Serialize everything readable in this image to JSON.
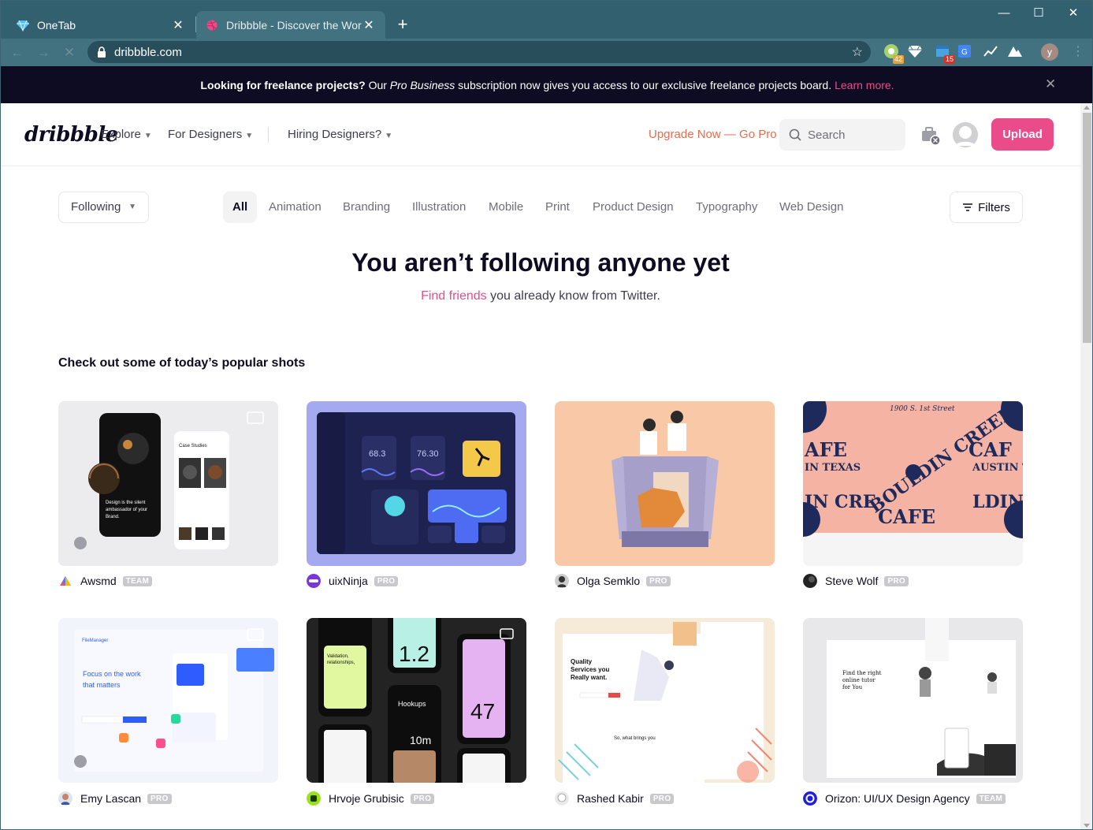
{
  "browser": {
    "tabs": [
      {
        "title": "OneTab",
        "active": false
      },
      {
        "title": "Dribbble - Discover the World",
        "active": true
      }
    ],
    "url": "dribbble.com",
    "extensions": [
      {
        "icon": "chrome-ext-icon",
        "badge": "42",
        "badge_color": "#e8a13a"
      },
      {
        "icon": "diamond-ext-icon",
        "badge": "",
        "badge_color": ""
      },
      {
        "icon": "calendar-ext-icon",
        "badge": "15",
        "badge_color": "#d93025"
      },
      {
        "icon": "translate-ext-icon",
        "badge": "",
        "badge_color": ""
      },
      {
        "icon": "chart-ext-icon",
        "badge": "",
        "badge_color": ""
      },
      {
        "icon": "mountain-ext-icon",
        "badge": "",
        "badge_color": ""
      }
    ],
    "profile_initial": "y"
  },
  "banner": {
    "lead": "Looking for freelance projects?",
    "mid1": "Our",
    "emph": "Pro Business",
    "rest": "subscription now gives you access to our exclusive freelance projects board.",
    "link": "Learn more."
  },
  "header": {
    "logo": "dribbble",
    "nav": [
      "Explore",
      "For Designers",
      "Hiring Designers?"
    ],
    "upgrade": "Upgrade Now — Go Pro",
    "search_placeholder": "Search",
    "upload": "Upload"
  },
  "filters": {
    "following": "Following",
    "categories": [
      "All",
      "Animation",
      "Branding",
      "Illustration",
      "Mobile",
      "Print",
      "Product Design",
      "Typography",
      "Web Design"
    ],
    "active_category": "All",
    "filters_label": "Filters"
  },
  "empty": {
    "title": "You aren’t following anyone yet",
    "link": "Find friends",
    "rest": "you already know from Twitter."
  },
  "popular_heading": "Check out some of today’s popular shots",
  "shots": [
    {
      "author": "Awsmd",
      "tag": "TEAM"
    },
    {
      "author": "uixNinja",
      "tag": "PRO"
    },
    {
      "author": "Olga Semklo",
      "tag": "PRO"
    },
    {
      "author": "Steve Wolf",
      "tag": "PRO"
    },
    {
      "author": "Emy Lascan",
      "tag": "PRO"
    },
    {
      "author": "Hrvoje Grubisic",
      "tag": "PRO"
    },
    {
      "author": "Rashed Kabir",
      "tag": "PRO"
    },
    {
      "author": "Orizon: UI/UX Design Agency",
      "tag": "TEAM"
    }
  ],
  "colors": {
    "brand_pink": "#ea4c89",
    "upgrade_orange": "#ea6c4b",
    "banner_bg": "#0d0c22",
    "chrome_frame": "#33606f"
  }
}
